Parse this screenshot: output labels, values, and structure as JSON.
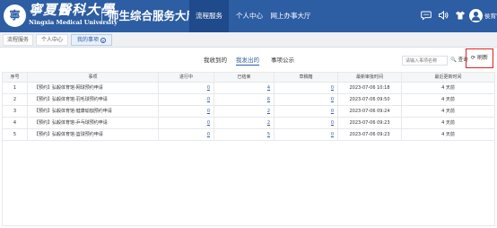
{
  "header": {
    "logo_cn": "寧夏醫科大學",
    "logo_en": "Ningxia Medical University",
    "logo_glyph": "寧",
    "hall_title": "师生综合服务大厅",
    "nav": [
      "流程服务",
      "个人中心",
      "网上办事大厅"
    ],
    "icons": [
      "message-icon",
      "volume-icon",
      "shirt-icon"
    ],
    "username": "侯宵雪我的..."
  },
  "page_tabs": {
    "items": [
      "流程服务",
      "个人中心",
      "我的事项"
    ],
    "close_glyph": "×"
  },
  "sub_tabs": [
    "我收到的",
    "我发出的",
    "事项公示"
  ],
  "toolbar": {
    "search_placeholder": "请输入事项名称",
    "search_label": "🔍 查询",
    "refresh_label": "⟳ 刷新"
  },
  "table": {
    "headers": [
      "序号",
      "事项",
      "进行中",
      "已结束",
      "草稿箱",
      "最新审批时间",
      "最近更新时间"
    ],
    "rows": [
      {
        "no": "1",
        "item": "【预约】弘毅体育馆-网球预约申请",
        "ongoing": "0",
        "finished": "4",
        "draft": "0",
        "approve_time": "2023-07-06 10:18",
        "update": "4 天前"
      },
      {
        "no": "2",
        "item": "【预约】弘毅体育馆-羽毛球预约申请",
        "ongoing": "0",
        "finished": "6",
        "draft": "0",
        "approve_time": "2023-07-06 09:50",
        "update": "4 天前"
      },
      {
        "no": "3",
        "item": "【预约】弘毅体育馆-健康瑜伽预约申请",
        "ongoing": "0",
        "finished": "2",
        "draft": "0",
        "approve_time": "2023-07-06 09:24",
        "update": "4 天前"
      },
      {
        "no": "4",
        "item": "【预约】弘毅体育馆-乒乓球预约申请",
        "ongoing": "0",
        "finished": "2",
        "draft": "0",
        "approve_time": "2023-07-06 09:23",
        "update": "4 天前"
      },
      {
        "no": "5",
        "item": "【预约】弘毅体育馆-篮球预约申请",
        "ongoing": "0",
        "finished": "5",
        "draft": "0",
        "approve_time": "2023-07-06 09:23",
        "update": "4 天前"
      }
    ]
  },
  "colors": {
    "brand": "#2d5da3",
    "nav_active": "#1f4a8c",
    "highlight_box": "#e02020"
  }
}
